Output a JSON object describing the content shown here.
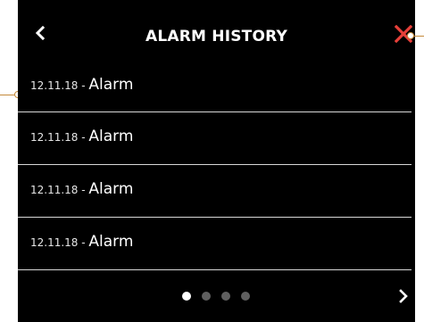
{
  "header": {
    "title": "ALARM HISTORY",
    "back_icon": "chevron-left-icon",
    "close_icon": "close-icon",
    "close_color": "#e8403a"
  },
  "alarms": [
    {
      "date": "12.11.18",
      "separator": " - ",
      "label": "Alarm"
    },
    {
      "date": "12.11.18",
      "separator": " - ",
      "label": "Alarm"
    },
    {
      "date": "12.11.18",
      "separator": " - ",
      "label": "Alarm"
    },
    {
      "date": "12.11.18",
      "separator": " - ",
      "label": "Alarm"
    }
  ],
  "pagination": {
    "total_pages": 4,
    "current_page": 1,
    "next_icon": "chevron-right-icon"
  },
  "colors": {
    "background": "#000000",
    "text": "#ffffff",
    "divider": "#d8d8d8",
    "dot_inactive": "#5f5f5f",
    "callout": "#c4893a"
  }
}
